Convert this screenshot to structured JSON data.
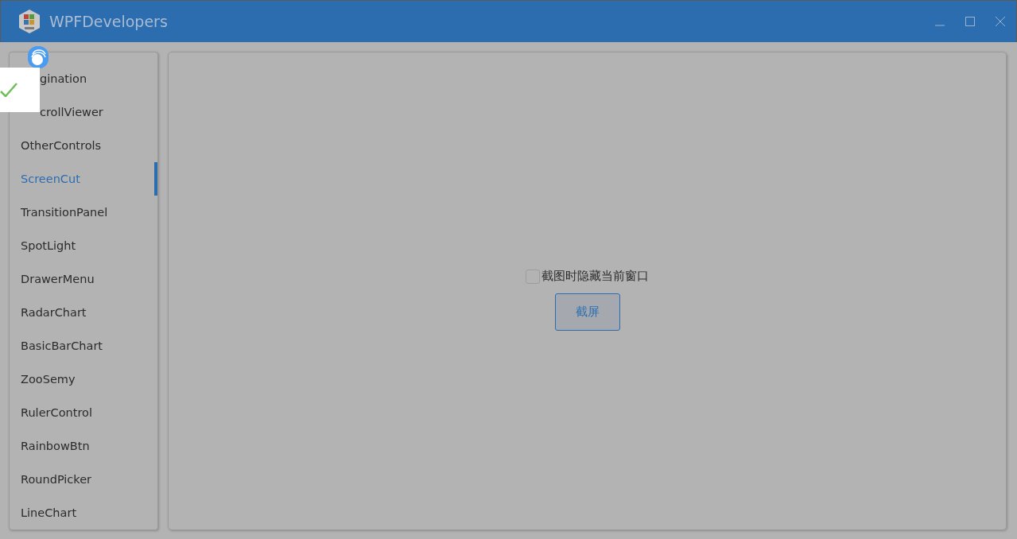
{
  "window": {
    "title": "WPFDevelopers"
  },
  "sidebar": {
    "items": [
      {
        "label": "gination",
        "selected": false,
        "kind": "clipped"
      },
      {
        "label": "crollViewer",
        "selected": false,
        "kind": "clipped"
      },
      {
        "label": "OtherControls",
        "selected": false
      },
      {
        "label": "ScreenCut",
        "selected": true
      },
      {
        "label": "TransitionPanel",
        "selected": false
      },
      {
        "label": "SpotLight",
        "selected": false
      },
      {
        "label": "DrawerMenu",
        "selected": false
      },
      {
        "label": "RadarChart",
        "selected": false
      },
      {
        "label": "BasicBarChart",
        "selected": false
      },
      {
        "label": "ZooSemy",
        "selected": false
      },
      {
        "label": "RulerControl",
        "selected": false
      },
      {
        "label": "RainbowBtn",
        "selected": false
      },
      {
        "label": "RoundPicker",
        "selected": false
      },
      {
        "label": "LineChart",
        "selected": false
      }
    ]
  },
  "content": {
    "checkbox": {
      "label": "截图时隐藏当前窗口",
      "checked": false
    },
    "button": "截屏"
  }
}
